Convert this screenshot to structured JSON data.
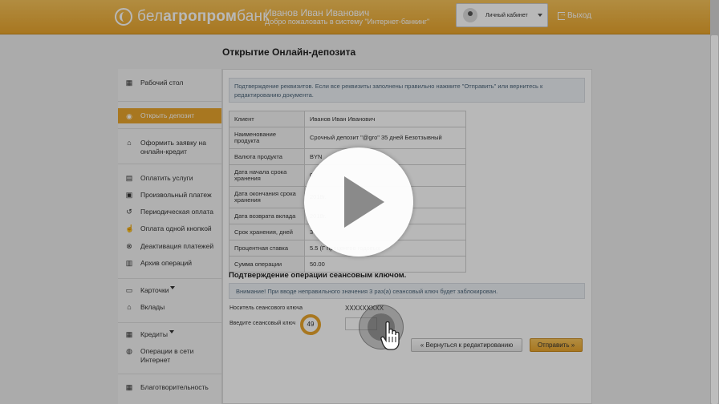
{
  "header": {
    "brand_prefix": "бел",
    "brand_middle": "агропром",
    "brand_suffix": "банк",
    "user_name": "Иванов Иван Иванович",
    "welcome": "Добро пожаловать в систему \"Интернет-банкинг\"",
    "cabinet_label": "Личный кабинет",
    "exit_label": "Выход"
  },
  "page_title": "Открытие Онлайн-депозита",
  "sidebar": {
    "items": [
      {
        "label": "Рабочий стол",
        "icon": "grid-icon"
      },
      {
        "label": "Открыть депозит",
        "icon": "coins-icon"
      },
      {
        "label": "Оформить заявку на онлайн-кредит",
        "icon": "bank-icon"
      },
      {
        "label": "Оплатить услуги",
        "icon": "document-icon"
      },
      {
        "label": "Произвольный платеж",
        "icon": "wallet-icon"
      },
      {
        "label": "Периодическая оплата",
        "icon": "history-icon"
      },
      {
        "label": "Оплата одной кнопкой",
        "icon": "touch-icon"
      },
      {
        "label": "Деактивация платежей",
        "icon": "cancel-icon"
      },
      {
        "label": "Архив операций",
        "icon": "archive-icon"
      },
      {
        "label": "Карточки",
        "icon": "card-icon"
      },
      {
        "label": "Вклады",
        "icon": "bank-icon"
      },
      {
        "label": "Кредиты",
        "icon": "grid-icon"
      },
      {
        "label": "Операции в сети Интернет",
        "icon": "globe-icon"
      },
      {
        "label": "Благотворительность",
        "icon": "grid-icon"
      }
    ]
  },
  "main": {
    "info_text": "Подтверждение реквизитов. Если все реквизиты заполнены правильно нажмите \"Отправить\" или вернитесь к редактированию документа.",
    "details": [
      {
        "label": "Клиент",
        "value": "Иванов Иван Иванович"
      },
      {
        "label": "Наименование продукта",
        "value": "Срочный депозит \"@gro\" 35 дней Безотзывный"
      },
      {
        "label": "Валюта продукта",
        "value": "BYN"
      },
      {
        "label": "Дата начала срока хранения",
        "value": "0"
      },
      {
        "label": "Дата окончания срока хранения",
        "value": "2018г."
      },
      {
        "label": "Дата возврата вклада",
        "value": "2018г."
      },
      {
        "label": "Срок хранения, дней",
        "value": "3"
      },
      {
        "label": "Процентная ставка",
        "value": "5.5 (Г процентов годовых"
      },
      {
        "label": "Сумма операции",
        "value": "50.00"
      }
    ],
    "confirm_title": "Подтверждение операции сеансовым ключом.",
    "warning_text": "Внимание! При вводе неправильного значения 3 раз(а) сеансовый ключ будет заблокирован.",
    "carrier_label": "Носитель сеансового ключа",
    "carrier_value": "XXXXXXXXX",
    "key_label": "Введите сеансовый ключ",
    "key_number": "49",
    "back_button": "« Вернуться к редактированию",
    "send_button": "Отправить »"
  },
  "overlay": {
    "play_icon": "play-icon",
    "cursor_icon": "hand-cursor-icon"
  }
}
